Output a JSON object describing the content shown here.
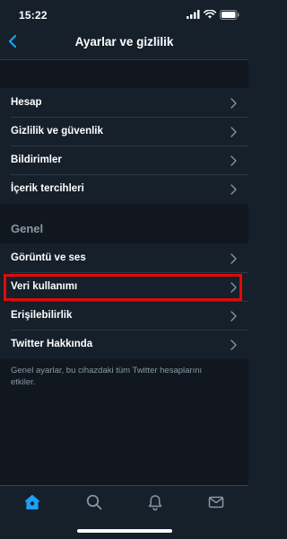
{
  "status_bar": {
    "time": "15:22",
    "icons": [
      "signal-icon",
      "wifi-icon",
      "battery-icon"
    ]
  },
  "nav": {
    "back_icon": "chevron-left-icon",
    "title": "Ayarlar ve gizlilik"
  },
  "account_section": {
    "items": [
      {
        "label": "Hesap"
      },
      {
        "label": "Gizlilik ve güvenlik"
      },
      {
        "label": "Bildirimler"
      },
      {
        "label": "İçerik tercihleri"
      }
    ]
  },
  "general_section": {
    "header": "Genel",
    "items": [
      {
        "label": "Görüntü ve ses"
      },
      {
        "label": "Veri kullanımı",
        "highlighted": true
      },
      {
        "label": "Erişilebilirlik"
      },
      {
        "label": "Twitter Hakkında"
      }
    ],
    "footer_note": "Genel ayarlar, bu cihazdaki tüm Twitter hesaplarını etkiler."
  },
  "tab_bar": {
    "tabs": [
      {
        "icon": "home-icon",
        "active": true
      },
      {
        "icon": "search-icon",
        "active": false
      },
      {
        "icon": "notifications-bell-icon",
        "active": false
      },
      {
        "icon": "messages-envelope-icon",
        "active": false
      }
    ]
  },
  "colors": {
    "background": "#15202b",
    "section_gap": "#10171e",
    "accent": "#1da1f2",
    "secondary_text": "#8899a6",
    "highlight_border": "#e00b0b"
  }
}
